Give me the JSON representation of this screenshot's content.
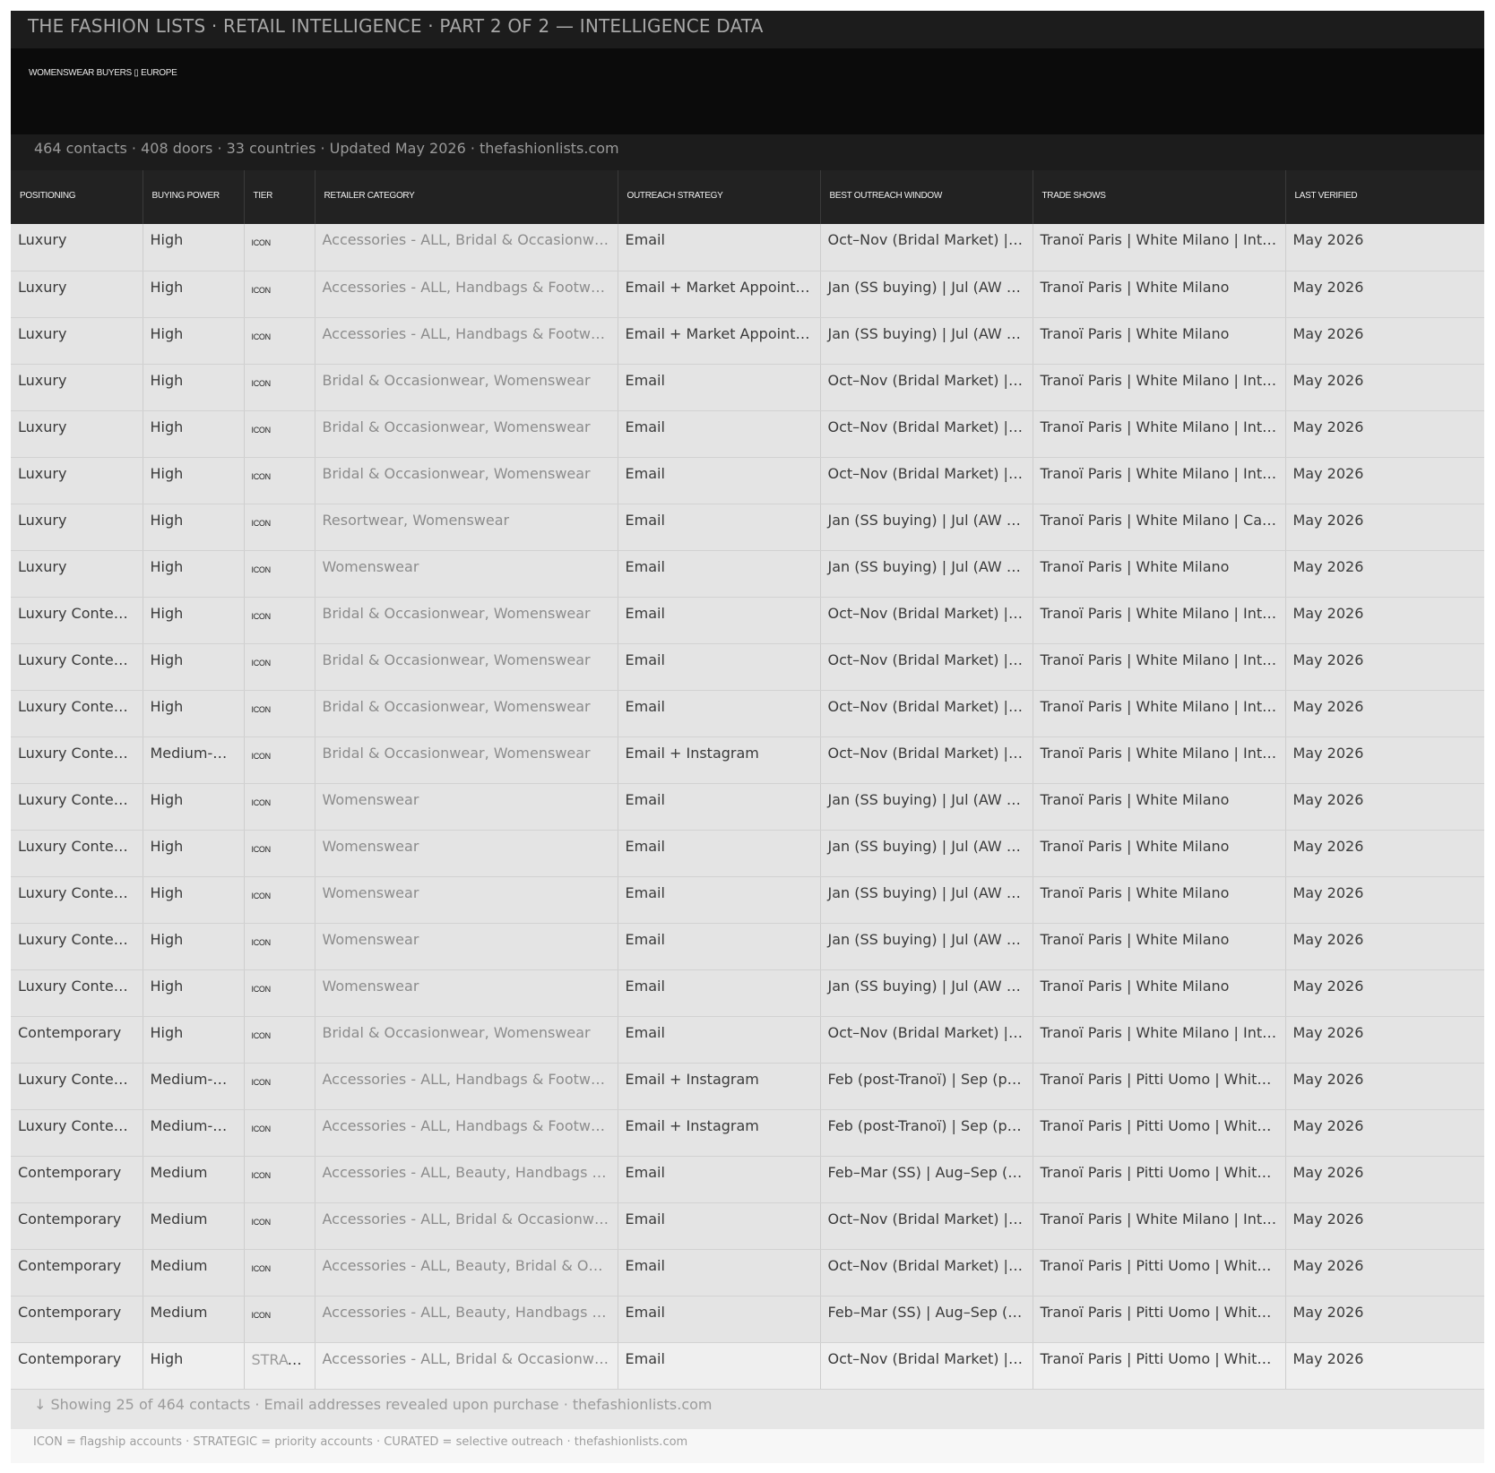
{
  "header": {
    "title": "THE FASHION LISTS  ·  RETAIL INTELLIGENCE  ·  PART 2 OF 2 — INTELLIGENCE DATA",
    "subtitle": "WOMENSWEAR BUYERS ▯ EUROPE",
    "stats": "464 contacts  ·  408 doors  ·  33 countries  ·  Updated May 2026  ·  thefashionlists.com"
  },
  "table": {
    "columns": [
      "POSITIONING",
      "BUYING POWER",
      "TIER",
      "RETAILER CATEGORY",
      "OUTREACH STRATEGY",
      "BEST OUTREACH WINDOW",
      "TRADE SHOWS",
      "LAST VERIFIED"
    ],
    "rows": [
      [
        "Luxury",
        "High",
        "ICON",
        "Accessories - ALL, Bridal & Occasionwear…",
        "Email",
        "Oct–Nov (Bridal Market) | A…",
        "Tranoï Paris | White Milano | Inter…",
        "May 2026"
      ],
      [
        "Luxury",
        "High",
        "ICON",
        "Accessories - ALL, Handbags & Footwear…",
        "Email + Market Appointm…",
        "Jan (SS buying) | Jul (AW bu…",
        "Tranoï Paris | White Milano",
        "May 2026"
      ],
      [
        "Luxury",
        "High",
        "ICON",
        "Accessories - ALL, Handbags & Footwear…",
        "Email + Market Appointm…",
        "Jan (SS buying) | Jul (AW bu…",
        "Tranoï Paris | White Milano",
        "May 2026"
      ],
      [
        "Luxury",
        "High",
        "ICON",
        "Bridal & Occasionwear, Womenswear",
        "Email",
        "Oct–Nov (Bridal Market) | A…",
        "Tranoï Paris | White Milano | Inter…",
        "May 2026"
      ],
      [
        "Luxury",
        "High",
        "ICON",
        "Bridal & Occasionwear, Womenswear",
        "Email",
        "Oct–Nov (Bridal Market) | A…",
        "Tranoï Paris | White Milano | Inter…",
        "May 2026"
      ],
      [
        "Luxury",
        "High",
        "ICON",
        "Bridal & Occasionwear, Womenswear",
        "Email",
        "Oct–Nov (Bridal Market) | A…",
        "Tranoï Paris | White Milano | Inter…",
        "May 2026"
      ],
      [
        "Luxury",
        "High",
        "ICON",
        "Resortwear, Womenswear",
        "Email",
        "Jan (SS buying) | Jul (AW bu…",
        "Tranoï Paris | White Milano | Caba…",
        "May 2026"
      ],
      [
        "Luxury",
        "High",
        "ICON",
        "Womenswear",
        "Email",
        "Jan (SS buying) | Jul (AW bu…",
        "Tranoï Paris | White Milano",
        "May 2026"
      ],
      [
        "Luxury Contem…",
        "High",
        "ICON",
        "Bridal & Occasionwear, Womenswear",
        "Email",
        "Oct–Nov (Bridal Market) | A…",
        "Tranoï Paris | White Milano | Inter…",
        "May 2026"
      ],
      [
        "Luxury Contem…",
        "High",
        "ICON",
        "Bridal & Occasionwear, Womenswear",
        "Email",
        "Oct–Nov (Bridal Market) | A…",
        "Tranoï Paris | White Milano | Inter…",
        "May 2026"
      ],
      [
        "Luxury Contem…",
        "High",
        "ICON",
        "Bridal & Occasionwear, Womenswear",
        "Email",
        "Oct–Nov (Bridal Market) | A…",
        "Tranoï Paris | White Milano | Inter…",
        "May 2026"
      ],
      [
        "Luxury Contem…",
        "Medium-Hi…",
        "ICON",
        "Bridal & Occasionwear, Womenswear",
        "Email + Instagram",
        "Oct–Nov (Bridal Market) | A…",
        "Tranoï Paris | White Milano | Inter…",
        "May 2026"
      ],
      [
        "Luxury Contem…",
        "High",
        "ICON",
        "Womenswear",
        "Email",
        "Jan (SS buying) | Jul (AW bu…",
        "Tranoï Paris | White Milano",
        "May 2026"
      ],
      [
        "Luxury Contem…",
        "High",
        "ICON",
        "Womenswear",
        "Email",
        "Jan (SS buying) | Jul (AW bu…",
        "Tranoï Paris | White Milano",
        "May 2026"
      ],
      [
        "Luxury Contem…",
        "High",
        "ICON",
        "Womenswear",
        "Email",
        "Jan (SS buying) | Jul (AW bu…",
        "Tranoï Paris | White Milano",
        "May 2026"
      ],
      [
        "Luxury Contem…",
        "High",
        "ICON",
        "Womenswear",
        "Email",
        "Jan (SS buying) | Jul (AW bu…",
        "Tranoï Paris | White Milano",
        "May 2026"
      ],
      [
        "Luxury Contem…",
        "High",
        "ICON",
        "Womenswear",
        "Email",
        "Jan (SS buying) | Jul (AW bu…",
        "Tranoï Paris | White Milano",
        "May 2026"
      ],
      [
        "Contemporary",
        "High",
        "ICON",
        "Bridal & Occasionwear, Womenswear",
        "Email",
        "Oct–Nov (Bridal Market) | A…",
        "Tranoï Paris | White Milano | Inter…",
        "May 2026"
      ],
      [
        "Luxury Contem…",
        "Medium-Hi…",
        "ICON",
        "Accessories - ALL, Handbags & Footwear…",
        "Email + Instagram",
        "Feb (post-Tranoï) | Sep (pos…",
        "Tranoï Paris | Pitti Uomo | White …",
        "May 2026"
      ],
      [
        "Luxury Contem…",
        "Medium-Hi…",
        "ICON",
        "Accessories - ALL, Handbags & Footwear…",
        "Email + Instagram",
        "Feb (post-Tranoï) | Sep (pos…",
        "Tranoï Paris | Pitti Uomo | White …",
        "May 2026"
      ],
      [
        "Contemporary",
        "Medium",
        "ICON",
        "Accessories - ALL, Beauty, Handbags & F…",
        "Email",
        "Feb–Mar (SS) | Aug–Sep (AW)",
        "Tranoï Paris | Pitti Uomo | White …",
        "May 2026"
      ],
      [
        "Contemporary",
        "Medium",
        "ICON",
        "Accessories - ALL, Bridal & Occasionwear…",
        "Email",
        "Oct–Nov (Bridal Market) | A…",
        "Tranoï Paris | White Milano | Inter…",
        "May 2026"
      ],
      [
        "Contemporary",
        "Medium",
        "ICON",
        "Accessories - ALL, Beauty, Bridal & Occa…",
        "Email",
        "Oct–Nov (Bridal Market) | A…",
        "Tranoï Paris | Pitti Uomo | White …",
        "May 2026"
      ],
      [
        "Contemporary",
        "Medium",
        "ICON",
        "Accessories - ALL, Beauty, Handbags & F…",
        "Email",
        "Feb–Mar (SS) | Aug–Sep (AW)",
        "Tranoï Paris | Pitti Uomo | White …",
        "May 2026"
      ],
      [
        "Contemporary",
        "High",
        "STRAT…",
        "Accessories - ALL, Bridal & Occasionwear…",
        "Email",
        "Oct–Nov (Bridal Market) | A…",
        "Tranoï Paris | Pitti Uomo | White …",
        "May 2026"
      ]
    ]
  },
  "footer": {
    "showing": "↓  Showing 25 of 464 contacts  ·  Email addresses revealed upon purchase  ·  thefashionlists.com",
    "legend": "ICON = flagship accounts  ·  STRATEGIC = priority accounts  ·  CURATED = selective outreach  ·  thefashionlists.com"
  },
  "colors": {
    "header_dark": "#1c1c1c",
    "hero_black": "#0b0b0b",
    "row_bg": "#e4e4e4",
    "muted_text": "#8c8c8c"
  }
}
